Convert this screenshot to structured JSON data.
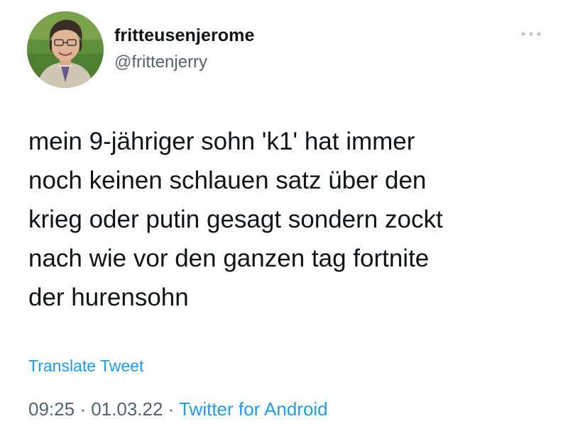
{
  "tweet": {
    "author": {
      "display_name": "fritteusenjerome",
      "handle": "@frittenjerry",
      "avatar_icon": "profile-photo"
    },
    "more_icon": "more-options-icon",
    "text_lines": [
      "mein 9-jähriger sohn 'k1' hat immer",
      "noch keinen schlauen satz über den",
      "krieg oder putin gesagt sondern zockt",
      "nach wie vor den ganzen tag fortnite",
      "der hurensohn"
    ],
    "translate_label": "Translate Tweet",
    "time": "09:25",
    "separator": "·",
    "date": "01.03.22",
    "source": "Twitter for Android"
  },
  "colors": {
    "text": "#0f1419",
    "secondary": "#536471",
    "link": "#1d9bf0",
    "background": "#ffffff"
  }
}
